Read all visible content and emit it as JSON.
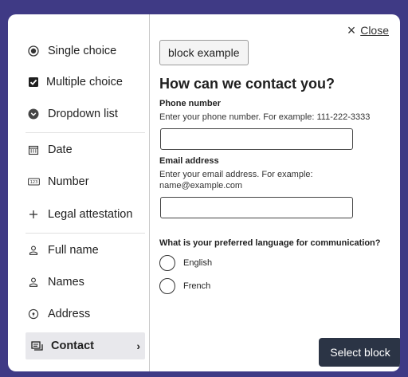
{
  "close": {
    "label": "Close",
    "icon": "close-icon"
  },
  "sidebar": {
    "items": [
      {
        "label": "Single choice",
        "icon": "radio-selected-icon"
      },
      {
        "label": "Multiple choice",
        "icon": "checkbox-checked-icon"
      },
      {
        "label": "Dropdown list",
        "icon": "dropdown-icon"
      },
      {
        "label": "Date",
        "icon": "calendar-icon"
      },
      {
        "label": "Number",
        "icon": "number-icon"
      },
      {
        "label": "Legal attestation",
        "icon": "plus-icon"
      },
      {
        "label": "Full name",
        "icon": "person-icon"
      },
      {
        "label": "Names",
        "icon": "person-icon"
      },
      {
        "label": "Address",
        "icon": "location-pin-icon"
      },
      {
        "label": "Contact",
        "icon": "contact-icon",
        "selected": true
      }
    ]
  },
  "main": {
    "chip_label": "block example",
    "heading": "How can we contact you?",
    "phone": {
      "label": "Phone number",
      "hint": "Enter your phone number. For example: 111-222-3333",
      "value": ""
    },
    "email": {
      "label": "Email address",
      "hint": "Enter your email address. For example: name@example.com",
      "value": ""
    },
    "language": {
      "question": "What is your preferred language for communication?",
      "options": [
        "English",
        "French"
      ]
    },
    "select_button": "Select block"
  },
  "colors": {
    "backdrop": "#3f3a85",
    "primary_button": "#2b3445",
    "selected_item_bg": "#e8e8ec"
  }
}
